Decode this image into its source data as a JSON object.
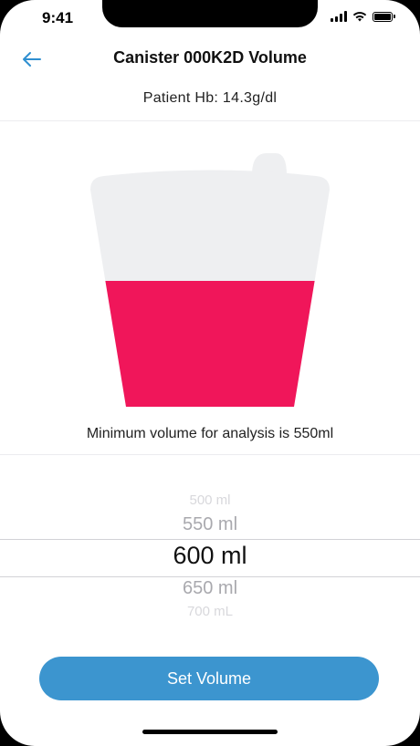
{
  "status_bar": {
    "time": "9:41"
  },
  "header": {
    "back_icon": "arrow-left-icon",
    "title": "Canister 000K2D Volume",
    "subtitle": "Patient Hb: 14.3g/dl"
  },
  "canister": {
    "fill_fraction": 0.58,
    "fill_color": "#f0165a",
    "body_color": "#eeeff1"
  },
  "note": "Minimum volume for analysis is 550ml",
  "picker": {
    "options": [
      "500 ml",
      "550 ml",
      "600 ml",
      "650 ml",
      "700 mL"
    ],
    "selected": "600 ml"
  },
  "cta": {
    "label": "Set Volume",
    "color": "#3c95cf"
  }
}
